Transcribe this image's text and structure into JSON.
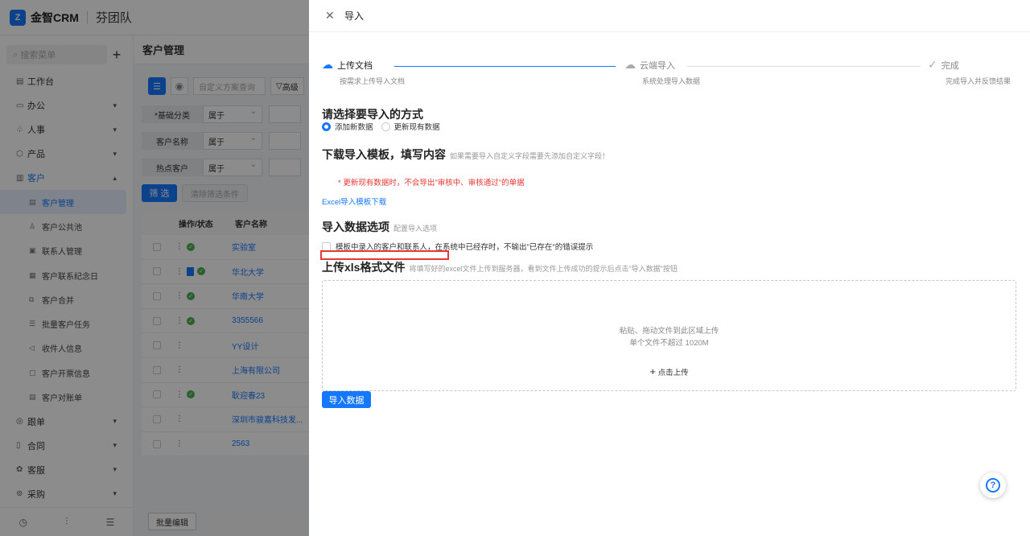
{
  "app": {
    "brand": "金智CRM",
    "team": "芬团队"
  },
  "sidebar": {
    "search_placeholder": "搜索菜单",
    "menu": [
      {
        "label": "工作台",
        "icon": "workbench-icon"
      },
      {
        "label": "办公",
        "icon": "office-icon"
      },
      {
        "label": "人事",
        "icon": "hr-icon"
      },
      {
        "label": "产品",
        "icon": "product-icon"
      },
      {
        "label": "客户",
        "icon": "customer-icon"
      }
    ],
    "sub_menu": [
      "客户管理",
      "客户公共池",
      "联系人管理",
      "客户联系纪念日",
      "客户合并",
      "批量客户任务",
      "收件人信息",
      "客户开票信息",
      "客户对账单"
    ],
    "menu_after": [
      {
        "label": "跟单",
        "icon": "follow-icon"
      },
      {
        "label": "合同",
        "icon": "contract-icon"
      },
      {
        "label": "客服",
        "icon": "service-icon"
      },
      {
        "label": "采购",
        "icon": "purchase-icon"
      }
    ]
  },
  "main": {
    "title": "客户管理",
    "query_placeholder": "自定义方案查询",
    "advanced_label": "高级",
    "filters": [
      {
        "label": "*基础分类",
        "op": "属于"
      },
      {
        "label": "客户名称",
        "op": "属于"
      },
      {
        "label": "热点客户",
        "op": "属于"
      }
    ],
    "filter_btn": "筛 选",
    "clear_btn": "清除筛选条件",
    "columns": [
      "操作/状态",
      "客户名称"
    ],
    "rows": [
      "实验室",
      "华北大学",
      "华南大学",
      "3355566",
      "YY设计",
      "上海有限公司",
      "耿迎春23",
      "深圳市骏嘉科技发...",
      "2563"
    ],
    "batch_edit": "批量编辑"
  },
  "drawer": {
    "title": "导入",
    "steps": [
      {
        "title": "上传文档",
        "desc": "按需求上传导入文档"
      },
      {
        "title": "云端导入",
        "desc": "系统处理导入数据"
      },
      {
        "title": "完成",
        "desc": "完成导入并反馈结果"
      }
    ],
    "method_title": "请选择要导入的方式",
    "method_options": [
      "添加新数据",
      "更新现有数据"
    ],
    "template_title": "下载导入模板，填写内容",
    "template_sub": "如果需要导入自定义字段需要先添加自定义字段！",
    "warning": "* 更新现有数据时，不会导出\"审核中、审核通过\"的单据",
    "template_link": "Excel导入模板下载",
    "options_title": "导入数据选项",
    "options_sub": "配置导入选项",
    "option_check": "模板中录入的客户和联系人，在系统中已经存时，不输出\"已存在\"的错误提示",
    "upload_title": "上传xls格式文件",
    "upload_sub": "将填写好的excel文件上传到服务器，看到文件上传成功的提示后点击\"导入数据\"按钮",
    "upload_hint1": "粘贴、拖动文件到此区域上传",
    "upload_hint2": "单个文件不超过 1020M",
    "upload_btn": "点击上传",
    "import_btn": "导入数据"
  },
  "colors": {
    "accent": "#1677ff",
    "warning": "#e53935"
  }
}
